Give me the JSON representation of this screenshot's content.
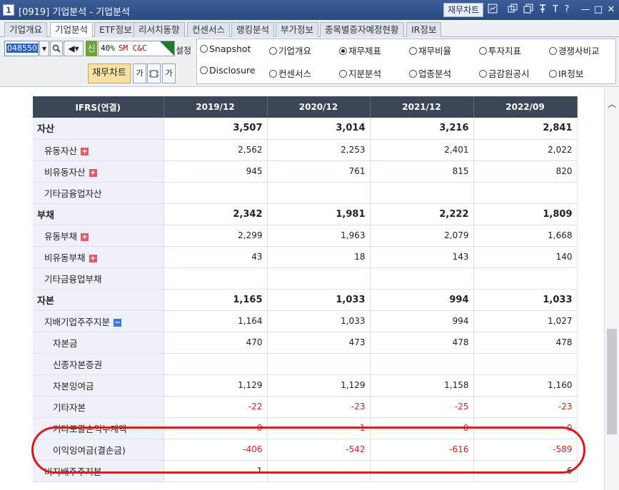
{
  "window": {
    "number": "1",
    "title": "[0919] 기업분석 - 기업분석",
    "title_button": "재무차트",
    "icons": [
      "chart-icon",
      "copy-icon",
      "window-icon",
      "pin-icon",
      "font-icon",
      "help-icon",
      "minimize-icon",
      "maximize-icon",
      "close-icon"
    ],
    "icon_glyphs": {
      "font": "T",
      "help": "?",
      "minimize": "—",
      "maximize": "□",
      "close": "✕"
    }
  },
  "tabs": [
    {
      "label": "기업개요",
      "active": false
    },
    {
      "label": "기업분석",
      "active": true
    },
    {
      "label": "ETF정보",
      "active": false
    },
    {
      "label": "리서치동향",
      "active": false
    },
    {
      "label": "컨센서스",
      "active": false
    },
    {
      "label": "랭킹분석",
      "active": false
    },
    {
      "label": "부가정보",
      "active": false
    },
    {
      "label": "종목별증자예정현황",
      "active": false
    },
    {
      "label": "IR정보",
      "active": false
    }
  ],
  "controls": {
    "stock_code": "048550",
    "badge": "신",
    "margin_rate": "40%",
    "stock_name": "SM C&C",
    "setting_label": "설정",
    "fin_chart_button": "재무차트",
    "small_button_1": "가",
    "small_button_3": "가"
  },
  "radios": [
    {
      "label": "Snapshot",
      "checked": false
    },
    {
      "label": "기업개요",
      "checked": false
    },
    {
      "label": "재무제표",
      "checked": true
    },
    {
      "label": "재무비율",
      "checked": false
    },
    {
      "label": "투자지표",
      "checked": false
    },
    {
      "label": "경쟁사비교",
      "checked": false
    },
    {
      "label": "Disclosure",
      "checked": false
    },
    {
      "label": "컨센서스",
      "checked": false
    },
    {
      "label": "지분분석",
      "checked": false
    },
    {
      "label": "업종분석",
      "checked": false
    },
    {
      "label": "금감원공시",
      "checked": false
    },
    {
      "label": "IR정보",
      "checked": false
    }
  ],
  "table": {
    "header": [
      "IFRS(연결)",
      "2019/12",
      "2020/12",
      "2021/12",
      "2022/09"
    ],
    "rows": [
      {
        "label": "자산",
        "level": 0,
        "bold": true,
        "values": [
          "3,507",
          "3,014",
          "3,216",
          "2,841"
        ]
      },
      {
        "label": "유동자산",
        "level": 1,
        "expand": "plus",
        "values": [
          "2,562",
          "2,253",
          "2,401",
          "2,022"
        ]
      },
      {
        "label": "비유동자산",
        "level": 1,
        "expand": "plus",
        "values": [
          "945",
          "761",
          "815",
          "820"
        ]
      },
      {
        "label": "기타금융업자산",
        "level": 1,
        "values": [
          "",
          "",
          "",
          ""
        ]
      },
      {
        "label": "부채",
        "level": 0,
        "bold": true,
        "values": [
          "2,342",
          "1,981",
          "2,222",
          "1,809"
        ]
      },
      {
        "label": "유동부채",
        "level": 1,
        "expand": "plus",
        "values": [
          "2,299",
          "1,963",
          "2,079",
          "1,668"
        ]
      },
      {
        "label": "비유동부채",
        "level": 1,
        "expand": "plus",
        "values": [
          "43",
          "18",
          "143",
          "140"
        ]
      },
      {
        "label": "기타금융업부채",
        "level": 1,
        "values": [
          "",
          "",
          "",
          ""
        ]
      },
      {
        "label": "자본",
        "level": 0,
        "bold": true,
        "values": [
          "1,165",
          "1,033",
          "994",
          "1,033"
        ]
      },
      {
        "label": "지배기업주주지분",
        "level": 1,
        "expand": "minus",
        "values": [
          "1,164",
          "1,033",
          "994",
          "1,027"
        ]
      },
      {
        "label": "자본금",
        "level": 2,
        "values": [
          "470",
          "473",
          "478",
          "478"
        ]
      },
      {
        "label": "신종자본증권",
        "level": 2,
        "values": [
          "",
          "",
          "",
          ""
        ]
      },
      {
        "label": "자본잉여금",
        "level": 2,
        "values": [
          "1,129",
          "1,129",
          "1,158",
          "1,160"
        ]
      },
      {
        "label": "기타자본",
        "level": 2,
        "negative": true,
        "values": [
          "-22",
          "-23",
          "-25",
          "-23"
        ]
      },
      {
        "label": "기타포괄손익누계액",
        "level": 2,
        "negative": true,
        "values": [
          "-0",
          "-1",
          "-0",
          "-0"
        ]
      },
      {
        "label": "이익잉여금(결손금)",
        "level": 2,
        "negative": true,
        "values": [
          "-406",
          "-542",
          "-616",
          "-589"
        ]
      },
      {
        "label": "비지배주주지분",
        "level": 1,
        "values": [
          "1",
          "",
          "",
          "6"
        ]
      }
    ]
  },
  "colors": {
    "title_bar": "#2a4a85",
    "header_bg": "#3b4656",
    "negative": "#d32020",
    "highlight": "#e0161c"
  }
}
